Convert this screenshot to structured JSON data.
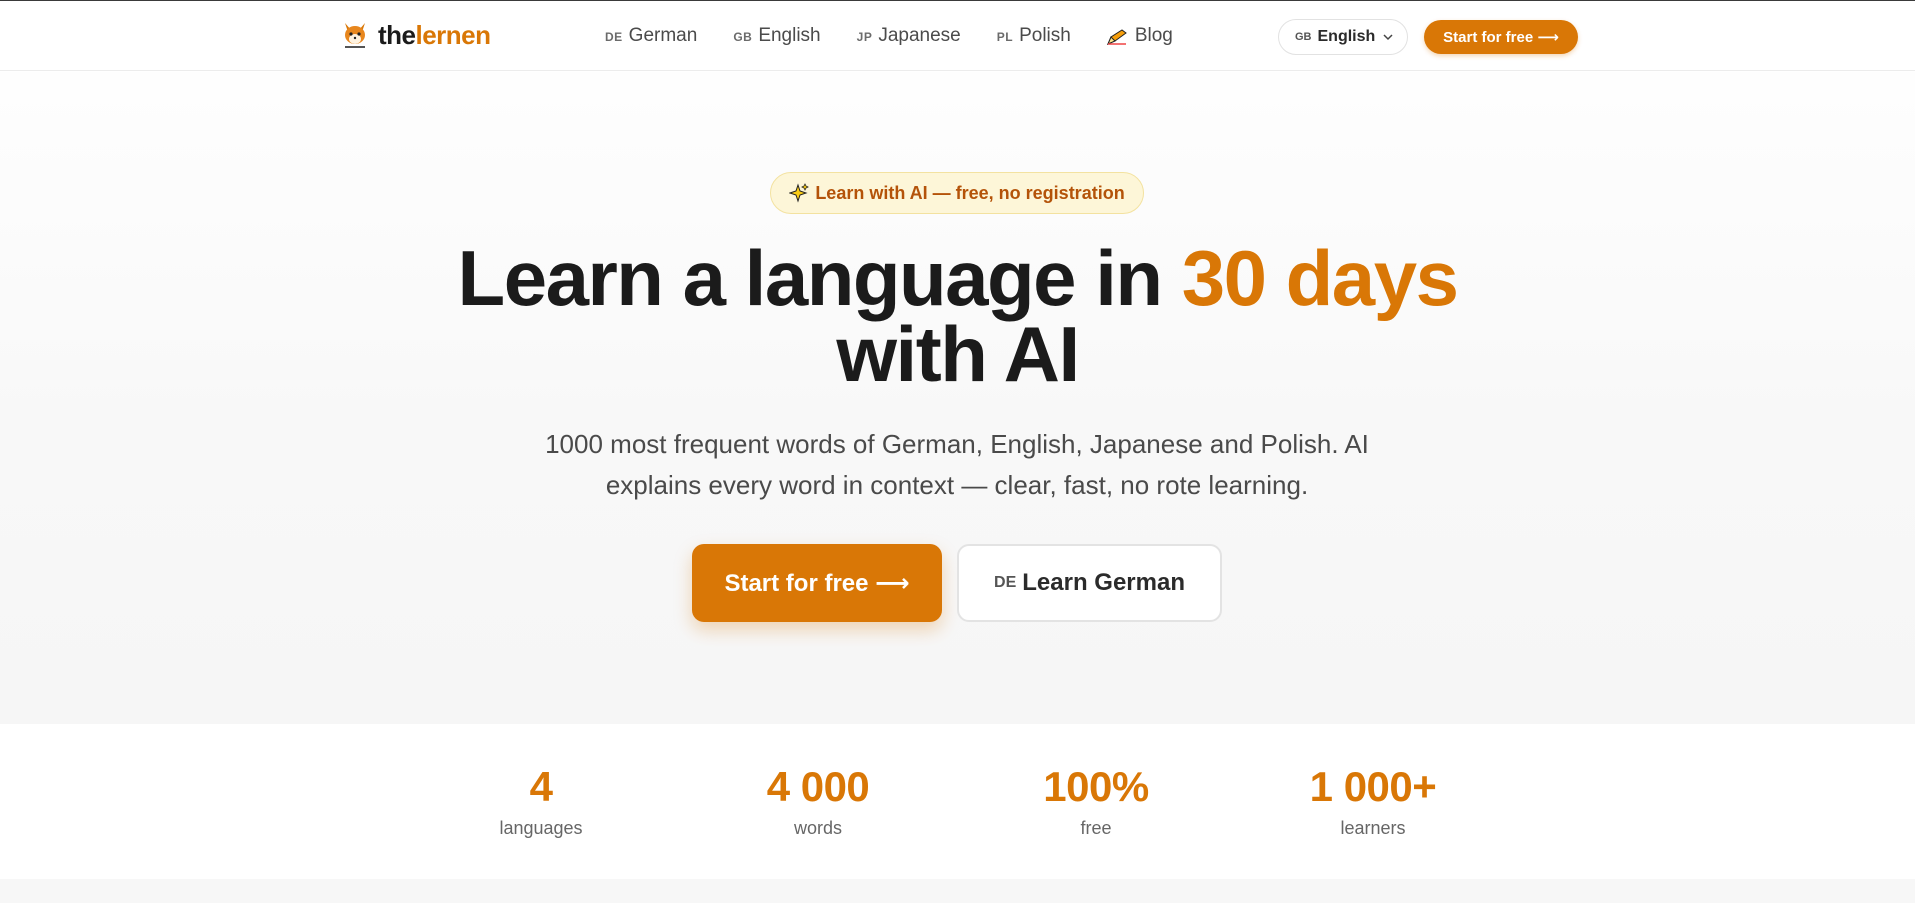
{
  "header": {
    "logo": {
      "the": "the",
      "lernen": "lernen"
    },
    "nav": [
      {
        "code": "DE",
        "label": "German"
      },
      {
        "code": "GB",
        "label": "English"
      },
      {
        "code": "JP",
        "label": "Japanese"
      },
      {
        "code": "PL",
        "label": "Polish"
      },
      {
        "icon": "pencil-icon",
        "label": "Blog"
      }
    ],
    "language_select": {
      "code": "GB",
      "value": "English"
    },
    "cta": "Start for free ⟶"
  },
  "hero": {
    "badge": "Learn with AI — free, no registration",
    "headline_part1": "Learn a language in ",
    "headline_accent": "30 days",
    "headline_part2": "with AI",
    "subtitle": "1000 most frequent words of German, English, Japanese and Polish. AI explains every word in context — clear, fast, no rote learning.",
    "primary_button": "Start for free ⟶",
    "secondary_button": {
      "code": "DE",
      "label": "Learn German"
    }
  },
  "stats": [
    {
      "value": "4",
      "label": "languages"
    },
    {
      "value": "4 000",
      "label": "words"
    },
    {
      "value": "100%",
      "label": "free"
    },
    {
      "value": "1 000+",
      "label": "learners"
    }
  ],
  "colors": {
    "accent": "#d97706",
    "text": "#1b1b1b",
    "badge_bg": "#fdf6d8"
  }
}
